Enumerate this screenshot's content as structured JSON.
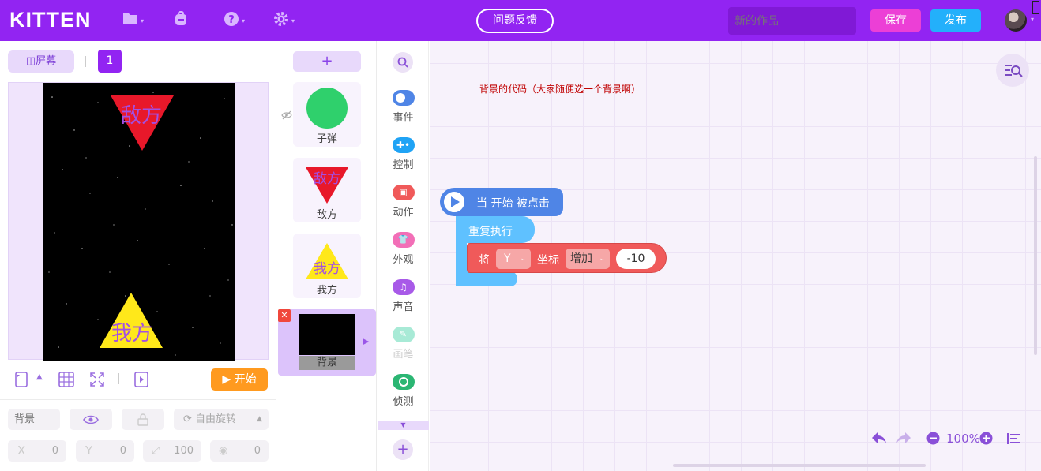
{
  "topbar": {
    "logo": "KITTEN",
    "feedback_label": "问题反馈",
    "work_name_placeholder": "新的作品",
    "save_label": "保存",
    "publish_label": "发布",
    "icons": [
      "folder-icon",
      "backpack-icon",
      "help-icon",
      "gear-icon"
    ]
  },
  "stage": {
    "screen_label": "屏幕",
    "page_number": "1",
    "enemy_label": "敌方",
    "player_label": "我方",
    "start_label": "开始"
  },
  "properties": {
    "name": "背景",
    "rotation_label": "自由旋转",
    "x_label": "X",
    "x_value": "0",
    "y_label": "Y",
    "y_value": "0",
    "size_value": "100",
    "direction_value": "0"
  },
  "sprites": {
    "add_label": "+",
    "items": [
      {
        "name": "子弹"
      },
      {
        "name": "敌方",
        "thumb_text": "敌方"
      },
      {
        "name": "我方",
        "thumb_text": "我方"
      }
    ],
    "background": {
      "name": "背景"
    }
  },
  "categories": [
    {
      "label": "事件",
      "color": "#4f85e6"
    },
    {
      "label": "控制",
      "color": "#1fa3f5"
    },
    {
      "label": "动作",
      "color": "#f05a5a"
    },
    {
      "label": "外观",
      "color": "#f26fb7"
    },
    {
      "label": "声音",
      "color": "#a85ae8"
    },
    {
      "label": "画笔",
      "color": "#a8ead6"
    },
    {
      "label": "侦测",
      "color": "#2bb673"
    }
  ],
  "workspace": {
    "comment": "背景的代码（大家随便选一个背景啊）",
    "hat_block": "当 开始 被点击",
    "repeat_block": "重复执行",
    "move_block": {
      "prefix": "将",
      "axis": "Y",
      "mid": "坐标",
      "op": "增加",
      "value": "-10"
    },
    "zoom": "100%"
  },
  "colors": {
    "brand": "#9224f2",
    "save": "#ec3fd6",
    "publish": "#23b0fb",
    "start": "#ff9a1f"
  }
}
